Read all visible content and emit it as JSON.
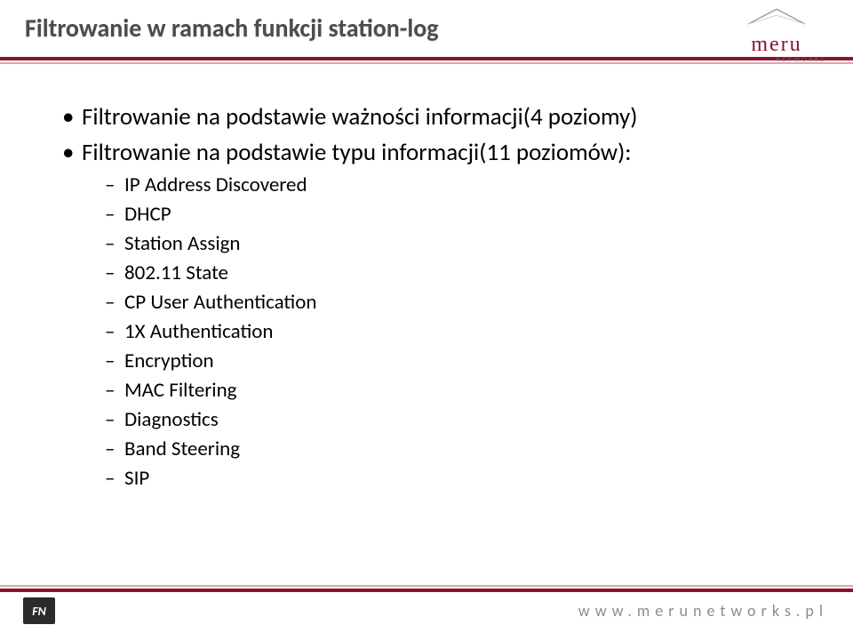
{
  "brand": {
    "logo_word": "meru",
    "logo_sub": "NETWORKS",
    "footer_mark": "FN"
  },
  "header": {
    "title": "Filtrowanie w ramach funkcji station-log"
  },
  "bullets": [
    {
      "text": "Filtrowanie na podstawie ważności informacji(4 poziomy)"
    },
    {
      "text": "Filtrowanie na podstawie typu informacji(11 poziomów):",
      "children": [
        "IP Address Discovered",
        "DHCP",
        "Station Assign",
        "802.11 State",
        "CP User Authentication",
        "1X Authentication",
        "Encryption",
        "MAC Filtering",
        "Diagnostics",
        "Band Steering",
        "SIP"
      ]
    }
  ],
  "footer": {
    "url": "www.merunetworks.pl"
  }
}
